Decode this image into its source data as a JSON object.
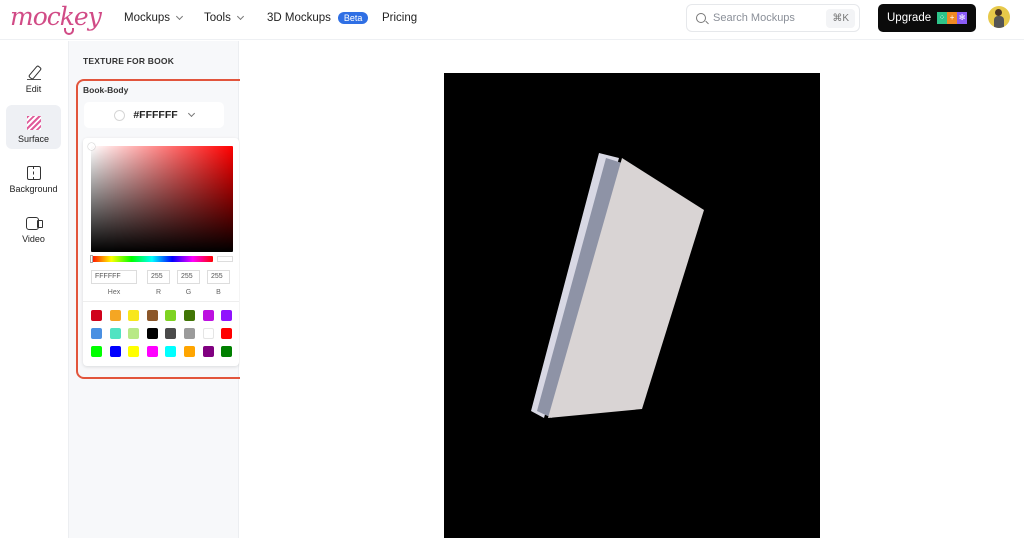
{
  "app": {
    "logo_text": "mockey"
  },
  "nav": {
    "items": [
      {
        "label": "Mockups",
        "has_dropdown": true
      },
      {
        "label": "Tools",
        "has_dropdown": true
      },
      {
        "label": "3D Mockups",
        "badge": "Beta"
      },
      {
        "label": "Pricing"
      }
    ],
    "search": {
      "placeholder": "Search Mockups",
      "shortcut": "⌘K"
    },
    "upgrade": {
      "label": "Upgrade",
      "badge_icons": [
        "sparkle-icon",
        "plus-icon",
        "star-icon"
      ],
      "badge_colors": [
        "#2ec48a",
        "#f08a24",
        "#8b5cf6"
      ]
    }
  },
  "rail": {
    "items": [
      {
        "label": "Edit",
        "icon": "pencil-icon",
        "active": false
      },
      {
        "label": "Surface",
        "icon": "texture-icon",
        "active": true
      },
      {
        "label": "Background",
        "icon": "background-icon",
        "active": false
      },
      {
        "label": "Video",
        "icon": "video-icon",
        "active": false
      }
    ]
  },
  "panel": {
    "title": "TEXTURE FOR BOOK",
    "section_label": "Book-Body",
    "selected_color": "#FFFFFF",
    "picker": {
      "hex": "FFFFFF",
      "r": "255",
      "g": "255",
      "b": "255",
      "labels": {
        "hex": "Hex",
        "r": "R",
        "g": "G",
        "b": "B"
      },
      "presets": [
        "#d0021b",
        "#f5a623",
        "#f8e71c",
        "#8b572a",
        "#7ed321",
        "#417505",
        "#bd10e0",
        "#9013fe",
        "#4a90e2",
        "#50e3c2",
        "#b8e986",
        "#000000",
        "#4a4a4a",
        "#9b9b9b",
        "#ffffff",
        "#ff0000",
        "#00ff00",
        "#0000ff",
        "#ffff00",
        "#ff00ff",
        "#00ffff",
        "#ffa500",
        "#800080",
        "#008000"
      ]
    }
  },
  "colors": {
    "accent_highlight": "#e2553c",
    "beta_badge": "#2f6fe4",
    "logo": "#d14b86"
  }
}
